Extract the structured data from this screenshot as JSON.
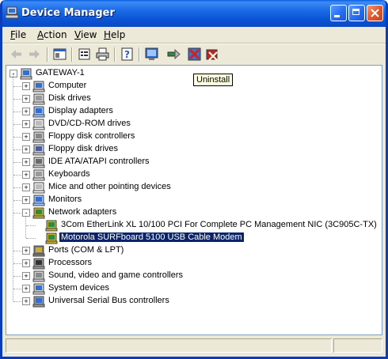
{
  "window": {
    "title": "Device Manager",
    "accent": "#0a55d6"
  },
  "menu": {
    "items": [
      {
        "key": "F",
        "rest": "ile",
        "name": "menu-file"
      },
      {
        "key": "A",
        "rest": "ction",
        "name": "menu-action"
      },
      {
        "key": "V",
        "rest": "iew",
        "name": "menu-view"
      },
      {
        "key": "H",
        "rest": "elp",
        "name": "menu-help"
      }
    ]
  },
  "toolbar": {
    "buttons": [
      "back-icon",
      "forward-icon",
      "show-hide-tree-icon",
      "properties-icon",
      "print-icon",
      "help-icon",
      "scan-hardware-icon",
      "update-driver-icon",
      "disable-icon",
      "uninstall-icon"
    ]
  },
  "tooltip": {
    "text": "Uninstall"
  },
  "tree": {
    "root": {
      "label": "GATEWAY-1",
      "icon": "computer-icon"
    },
    "categories": [
      {
        "label": "Computer",
        "icon": "computer-icon"
      },
      {
        "label": "Disk drives",
        "icon": "disk-drive-icon"
      },
      {
        "label": "Display adapters",
        "icon": "display-adapter-icon"
      },
      {
        "label": "DVD/CD-ROM drives",
        "icon": "cdrom-icon"
      },
      {
        "label": "Floppy disk controllers",
        "icon": "floppy-controller-icon"
      },
      {
        "label": "Floppy disk drives",
        "icon": "floppy-drive-icon"
      },
      {
        "label": "IDE ATA/ATAPI controllers",
        "icon": "ide-controller-icon"
      },
      {
        "label": "Keyboards",
        "icon": "keyboard-icon"
      },
      {
        "label": "Mice and other pointing devices",
        "icon": "mouse-icon"
      },
      {
        "label": "Monitors",
        "icon": "monitor-icon"
      },
      {
        "label": "Network adapters",
        "icon": "network-adapter-icon",
        "expanded": true,
        "children": [
          {
            "label": "3Com EtherLink XL 10/100 PCI For Complete PC Management NIC (3C905C-TX)",
            "icon": "network-card-icon"
          },
          {
            "label": "Motorola SURFboard 5100 USB Cable Modem",
            "icon": "network-card-icon",
            "selected": true
          }
        ]
      },
      {
        "label": "Ports (COM & LPT)",
        "icon": "port-icon"
      },
      {
        "label": "Processors",
        "icon": "processor-icon"
      },
      {
        "label": "Sound, video and game controllers",
        "icon": "sound-icon"
      },
      {
        "label": "System devices",
        "icon": "system-device-icon"
      },
      {
        "label": "Universal Serial Bus controllers",
        "icon": "usb-icon"
      }
    ]
  }
}
